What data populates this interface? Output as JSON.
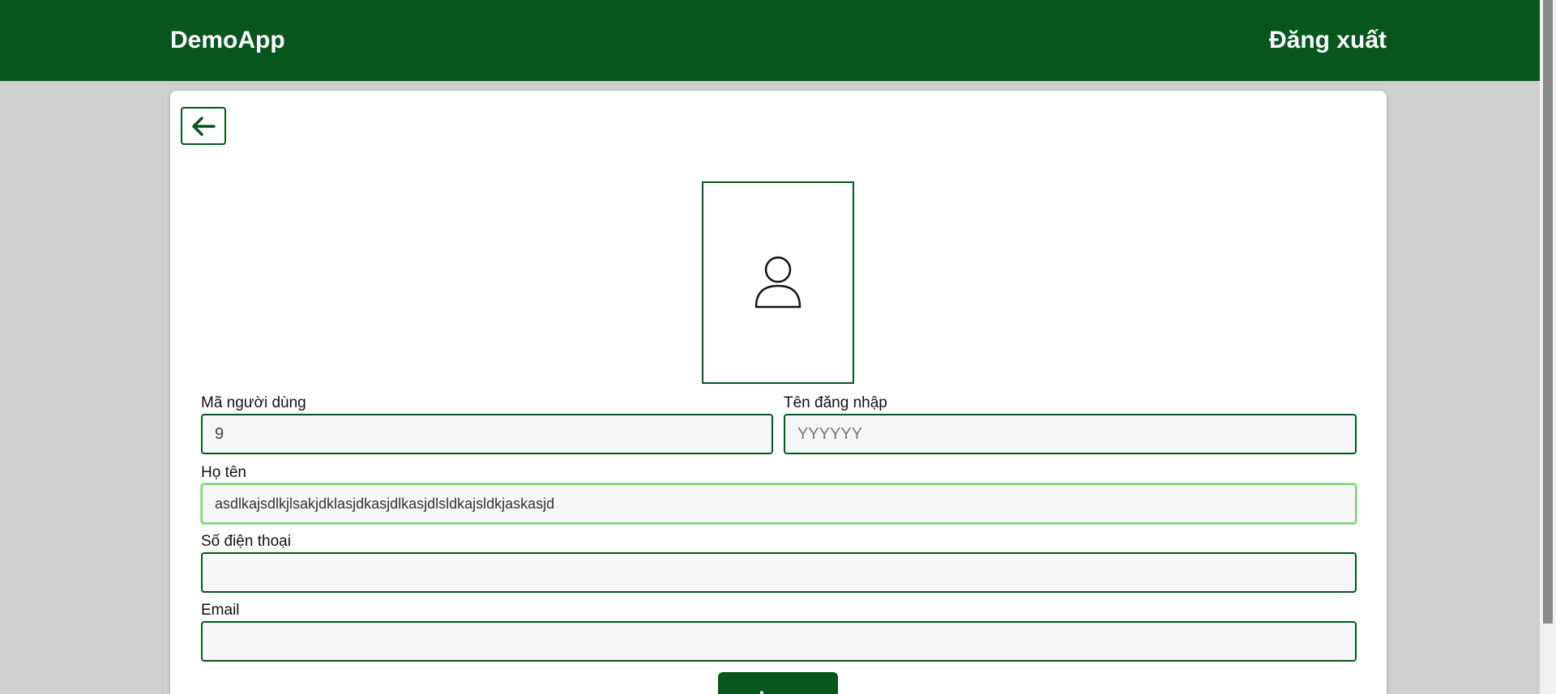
{
  "navbar": {
    "brand": "DemoApp",
    "logout_label": "Đăng xuất",
    "background": "#06561d"
  },
  "card": {
    "back_icon": "arrow-left-icon",
    "avatar_icon": "user-icon"
  },
  "form": {
    "user_id": {
      "label": "Mã người dùng",
      "value": "9"
    },
    "username": {
      "label": "Tên đăng nhập",
      "placeholder": "YYYYYY",
      "value": ""
    },
    "full_name": {
      "label": "Họ tên",
      "value": "asdlkajsdlkjlsakjdklasjdkasjdlkasjdlsldkajsldkjaskasjd"
    },
    "phone": {
      "label": "Số điện thoại",
      "value": ""
    },
    "email": {
      "label": "Email",
      "value": ""
    },
    "save_label": "Lưu"
  }
}
